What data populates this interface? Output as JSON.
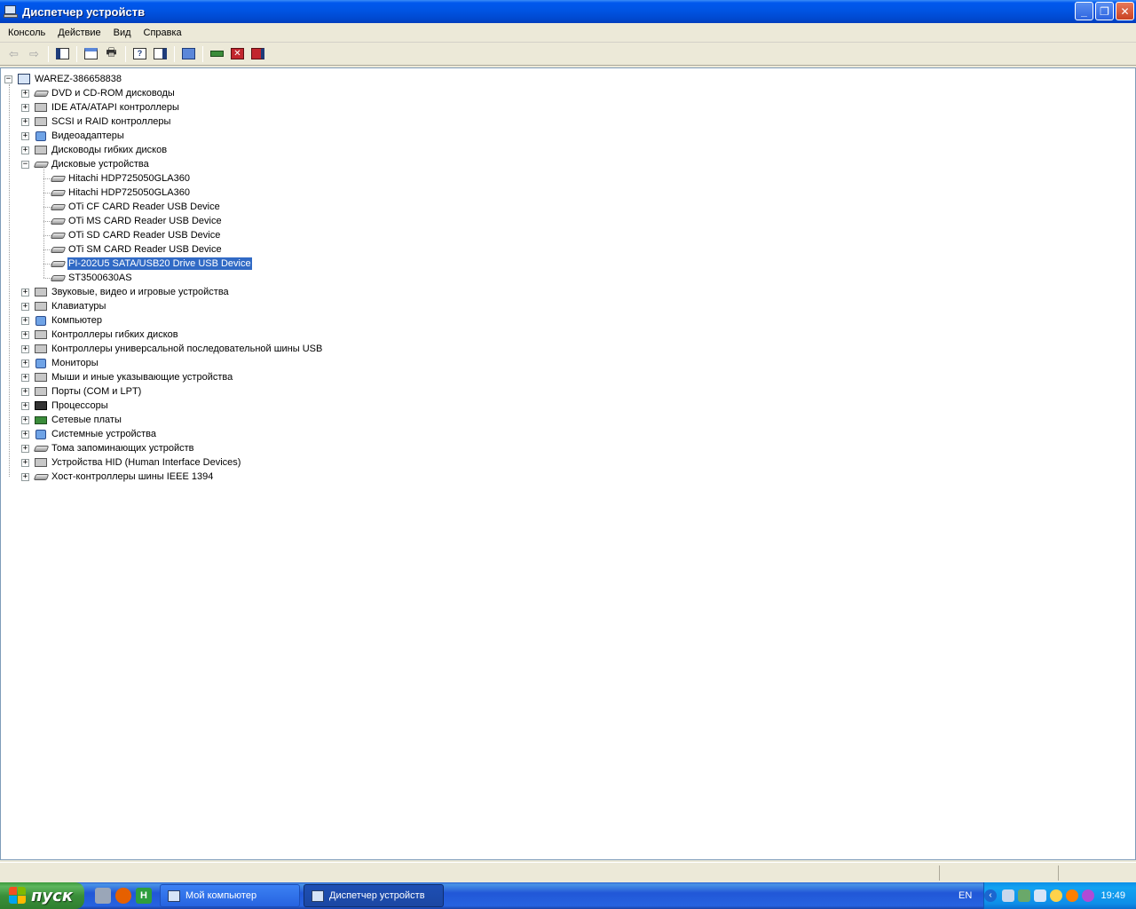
{
  "window": {
    "title": "Диспетчер устройств"
  },
  "menu": [
    "Консоль",
    "Действие",
    "Вид",
    "Справка"
  ],
  "tree": {
    "root": "WAREZ-386658838",
    "categories": [
      {
        "label": "DVD и CD-ROM дисководы",
        "expanded": false,
        "icon": "cdrom-icon"
      },
      {
        "label": "IDE ATA/ATAPI контроллеры",
        "expanded": false,
        "icon": "ide-controller-icon"
      },
      {
        "label": "SCSI и RAID контроллеры",
        "expanded": false,
        "icon": "scsi-icon"
      },
      {
        "label": "Видеоадаптеры",
        "expanded": false,
        "icon": "video-adapter-icon"
      },
      {
        "label": "Дисководы гибких дисков",
        "expanded": false,
        "icon": "floppy-drive-icon"
      },
      {
        "label": "Дисковые устройства",
        "expanded": true,
        "icon": "disk-drive-icon",
        "children": [
          "Hitachi HDP725050GLA360",
          "Hitachi HDP725050GLA360",
          "OTi CF CARD Reader USB Device",
          "OTi MS CARD Reader USB Device",
          "OTi SD CARD Reader USB Device",
          "OTi SM CARD Reader USB Device",
          "PI-202U5 SATA/USB20 Drive USB Device",
          "ST3500630AS"
        ],
        "selected_child": 6
      },
      {
        "label": "Звуковые, видео и игровые устройства",
        "expanded": false,
        "icon": "sound-icon"
      },
      {
        "label": "Клавиатуры",
        "expanded": false,
        "icon": "keyboard-icon"
      },
      {
        "label": "Компьютер",
        "expanded": false,
        "icon": "computer-icon"
      },
      {
        "label": "Контроллеры гибких дисков",
        "expanded": false,
        "icon": "floppy-controller-icon"
      },
      {
        "label": "Контроллеры универсальной последовательной шины USB",
        "expanded": false,
        "icon": "usb-icon"
      },
      {
        "label": "Мониторы",
        "expanded": false,
        "icon": "monitor-icon"
      },
      {
        "label": "Мыши и иные указывающие устройства",
        "expanded": false,
        "icon": "mouse-icon"
      },
      {
        "label": "Порты (COM и LPT)",
        "expanded": false,
        "icon": "port-icon"
      },
      {
        "label": "Процессоры",
        "expanded": false,
        "icon": "cpu-icon"
      },
      {
        "label": "Сетевые платы",
        "expanded": false,
        "icon": "network-card-icon"
      },
      {
        "label": "Системные устройства",
        "expanded": false,
        "icon": "system-device-icon"
      },
      {
        "label": "Тома запоминающих устройств",
        "expanded": false,
        "icon": "storage-volume-icon"
      },
      {
        "label": "Устройства HID (Human Interface Devices)",
        "expanded": false,
        "icon": "hid-icon"
      },
      {
        "label": "Хост-контроллеры шины IEEE 1394",
        "expanded": false,
        "icon": "ieee1394-icon"
      }
    ]
  },
  "taskbar": {
    "start_label": "пуск",
    "tasks": [
      {
        "label": "Мой компьютер",
        "active": false
      },
      {
        "label": "Диспетчер устройств",
        "active": true
      }
    ],
    "language": "EN",
    "clock": "19:49"
  }
}
